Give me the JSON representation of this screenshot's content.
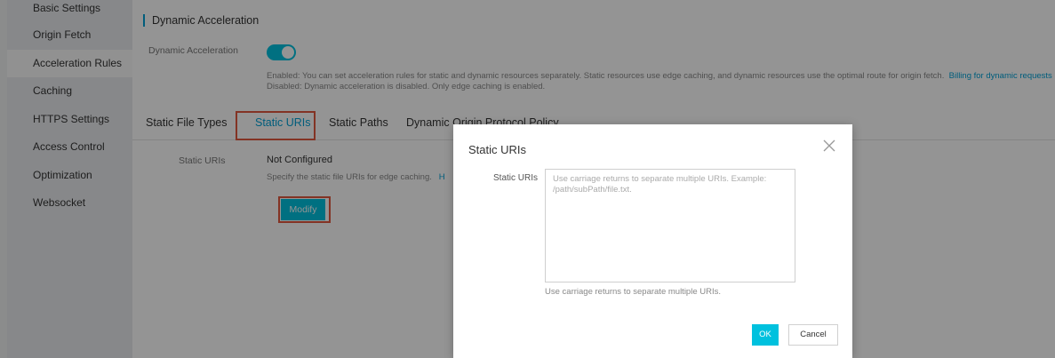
{
  "sidebar": {
    "items": [
      {
        "label": "Basic Settings"
      },
      {
        "label": "Origin Fetch"
      },
      {
        "label": "Acceleration Rules",
        "active": true
      },
      {
        "label": "Caching"
      },
      {
        "label": "HTTPS Settings"
      },
      {
        "label": "Access Control"
      },
      {
        "label": "Optimization"
      },
      {
        "label": "Websocket"
      }
    ]
  },
  "section": {
    "title": "Dynamic Acceleration",
    "toggle_label": "Dynamic Acceleration",
    "toggle_state": "on",
    "enabled_desc": "Enabled: You can set acceleration rules for static and dynamic resources separately. Static resources use edge caching, and dynamic resources use the optimal route for origin fetch.",
    "billing_link": "Billing for dynamic requests",
    "disabled_desc": "Disabled: Dynamic acceleration is disabled. Only edge caching is enabled."
  },
  "tabs": [
    {
      "label": "Static File Types"
    },
    {
      "label": "Static URIs",
      "active": true
    },
    {
      "label": "Static Paths"
    },
    {
      "label": "Dynamic Origin Protocol Policy"
    }
  ],
  "static_uris": {
    "label": "Static URIs",
    "value": "Not Configured",
    "hint": "Specify the static file URIs for edge caching.",
    "hint_link": "H",
    "modify_label": "Modify"
  },
  "dialog": {
    "title": "Static URIs",
    "field_label": "Static URIs",
    "placeholder": "Use carriage returns to separate multiple URIs. Example: /path/subPath/file.txt.",
    "help": "Use carriage returns to separate multiple URIs.",
    "ok_label": "OK",
    "cancel_label": "Cancel"
  },
  "colors": {
    "accent": "#00c1de",
    "link": "#00a1d6",
    "highlight": "#e2583e"
  }
}
